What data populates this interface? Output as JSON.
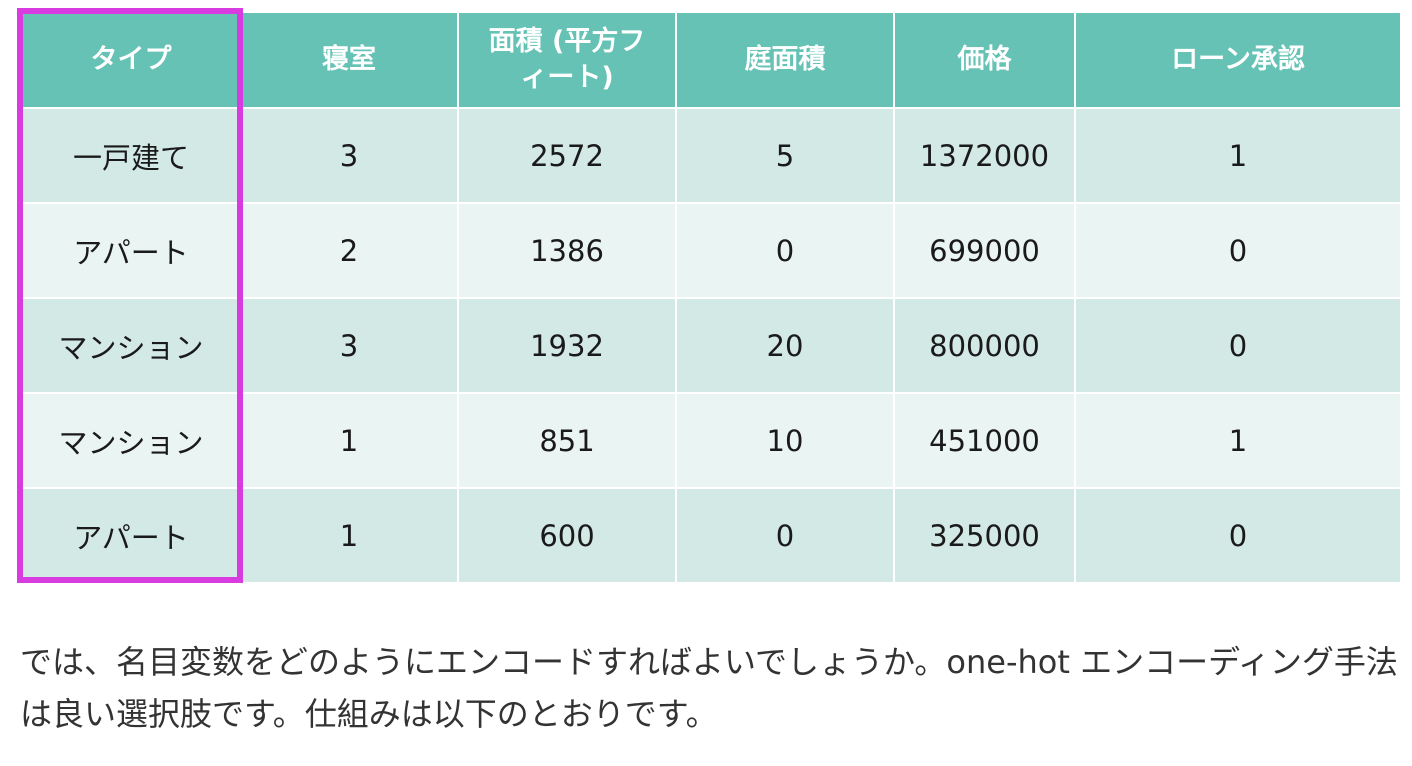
{
  "table": {
    "headers": [
      "タイプ",
      "寝室",
      "面積 (平方フィート)",
      "庭面積",
      "価格",
      "ローン承認"
    ],
    "rows": [
      [
        "一戸建て",
        "3",
        "2572",
        "5",
        "1372000",
        "1"
      ],
      [
        "アパート",
        "2",
        "1386",
        "0",
        "699000",
        "0"
      ],
      [
        "マンション",
        "3",
        "1932",
        "20",
        "800000",
        "0"
      ],
      [
        "マンション",
        "1",
        "851",
        "10",
        "451000",
        "1"
      ],
      [
        "アパート",
        "1",
        "600",
        "0",
        "325000",
        "0"
      ]
    ]
  },
  "highlight": {
    "column": "タイプ",
    "color": "#d83be0"
  },
  "colors": {
    "header_bg": "#65c2b5",
    "row_odd": "#d3e9e5",
    "row_even": "#eaf4f2"
  },
  "paragraph": {
    "text": "では、名目変数をどのようにエンコードすればよいでしょうか。one-hot エンコーディング手法は良い選択肢です。仕組みは以下のとおりです。"
  }
}
